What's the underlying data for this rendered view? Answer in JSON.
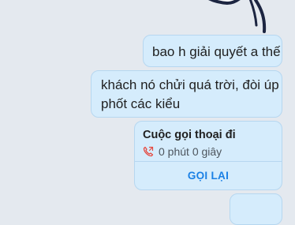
{
  "chat": {
    "messages": [
      {
        "text": "bao h giải quyết a thế"
      },
      {
        "lines": [
          "khách nó chửi quá trời, đòi úp",
          "phốt các kiểu"
        ]
      }
    ],
    "call_card": {
      "title": "Cuộc gọi thoại đi",
      "duration": "0 phút 0 giây",
      "action_label": "GỌI LẠI",
      "icon": "outgoing-call-icon"
    }
  },
  "colors": {
    "background": "#e4e9ef",
    "bubble": "#d5ecfc",
    "bubble_border": "#b6d7f0",
    "accent": "#1a80e5",
    "missed_red": "#e5483f"
  }
}
